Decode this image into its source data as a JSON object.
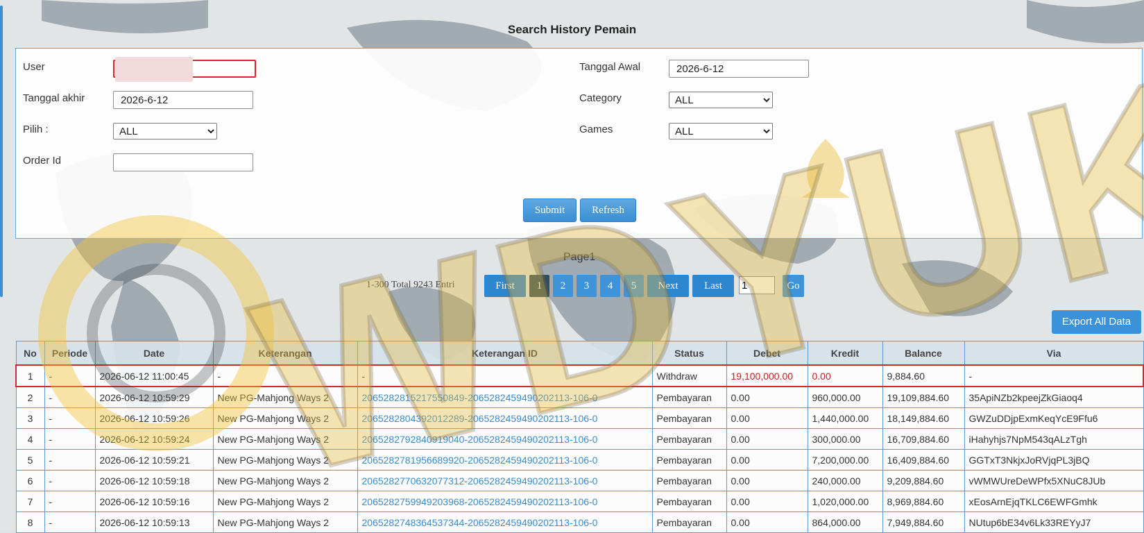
{
  "page_title": "Search History Pemain",
  "form": {
    "user_label": "User",
    "user_value": "",
    "tanggal_awal_label": "Tanggal Awal",
    "tanggal_awal_value": "2026-6-12",
    "tanggal_akhir_label": "Tanggal akhir",
    "tanggal_akhir_value": "2026-6-12",
    "category_label": "Category",
    "category_value": "ALL",
    "pilih_label": "Pilih  :",
    "pilih_value": "ALL",
    "games_label": "Games",
    "games_value": "ALL",
    "order_id_label": "Order Id",
    "order_id_value": "",
    "submit_label": "Submit",
    "refresh_label": "Refresh"
  },
  "pagination": {
    "page_label": "Page1",
    "entries_text": "1-300 Total 9243 Entri",
    "first_label": "First",
    "pages": [
      "1",
      "2",
      "3",
      "4",
      "5"
    ],
    "active_page": "1",
    "next_label": "Next",
    "last_label": "Last",
    "goto_value": "1",
    "go_label": "Go"
  },
  "export_label": "Export All Data",
  "watermark_text": "WDYUK",
  "table": {
    "columns": [
      "No",
      "Periode",
      "Date",
      "Keterangan",
      "Keterangan ID",
      "Status",
      "Debet",
      "Kredit",
      "Balance",
      "Via"
    ],
    "rows": [
      [
        "1",
        "-",
        "2026-06-12 11:00:45",
        "-",
        "-",
        "Withdraw",
        "19,100,000.00",
        "0.00",
        "9,884.60",
        "-"
      ],
      [
        "2",
        "-",
        "2026-06-12 10:59:29",
        "New PG-Mahjong Ways 2",
        "2065282815217550849-2065282459490202113-106-0",
        "Pembayaran",
        "0.00",
        "960,000.00",
        "19,109,884.60",
        "35ApiNZb2kpeejZkGiaoq4"
      ],
      [
        "3",
        "-",
        "2026-06-12 10:59:26",
        "New PG-Mahjong Ways 2",
        "2065282804392012289-2065282459490202113-106-0",
        "Pembayaran",
        "0.00",
        "1,440,000.00",
        "18,149,884.60",
        "GWZuDDjpExmKeqYcE9Ffu6"
      ],
      [
        "4",
        "-",
        "2026-06-12 10:59:24",
        "New PG-Mahjong Ways 2",
        "2065282792840919040-2065282459490202113-106-0",
        "Pembayaran",
        "0.00",
        "300,000.00",
        "16,709,884.60",
        "iHahyhjs7NpM543qALzTgh"
      ],
      [
        "5",
        "-",
        "2026-06-12 10:59:21",
        "New PG-Mahjong Ways 2",
        "2065282781956689920-2065282459490202113-106-0",
        "Pembayaran",
        "0.00",
        "7,200,000.00",
        "16,409,884.60",
        "GGTxT3NkjxJoRVjqPL3jBQ"
      ],
      [
        "6",
        "-",
        "2026-06-12 10:59:18",
        "New PG-Mahjong Ways 2",
        "2065282770632077312-2065282459490202113-106-0",
        "Pembayaran",
        "0.00",
        "240,000.00",
        "9,209,884.60",
        "vWMWUreDeWPfx5XNuC8JUb"
      ],
      [
        "7",
        "-",
        "2026-06-12 10:59:16",
        "New PG-Mahjong Ways 2",
        "2065282759949203968-2065282459490202113-106-0",
        "Pembayaran",
        "0.00",
        "1,020,000.00",
        "8,969,884.60",
        "xEosArnEjqTKLC6EWFGmhk"
      ],
      [
        "8",
        "-",
        "2026-06-12 10:59:13",
        "New PG-Mahjong Ways 2",
        "2065282748364537344-2065282459490202113-106-0",
        "Pembayaran",
        "0.00",
        "864,000.00",
        "7,949,884.60",
        "NUtup6bE34v6Lk33REYyJ7"
      ]
    ]
  }
}
